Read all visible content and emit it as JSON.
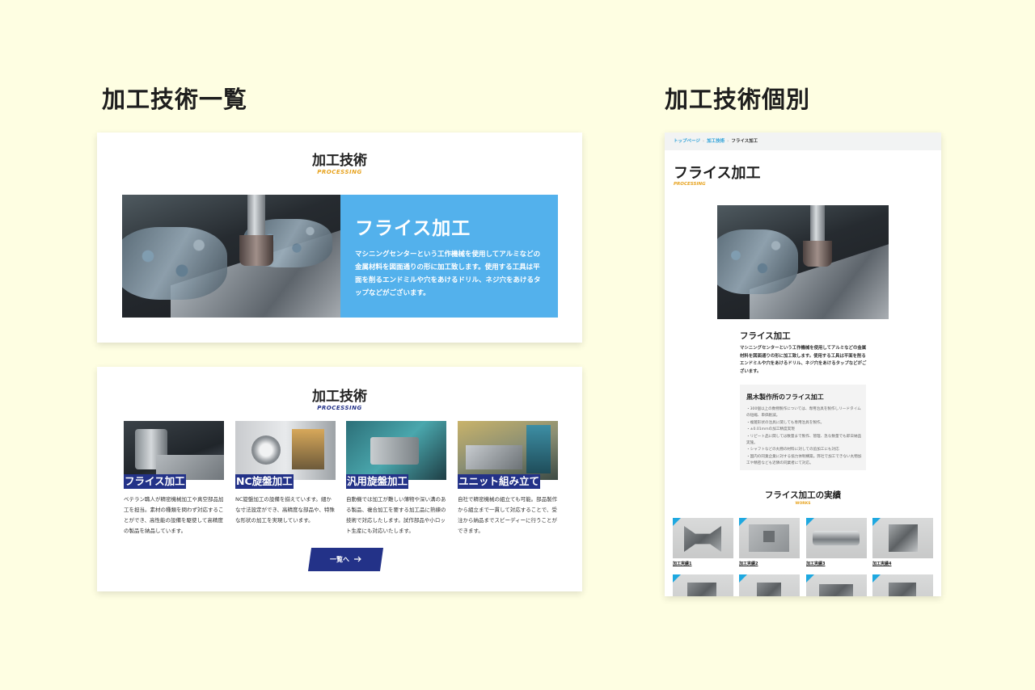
{
  "headings": {
    "list": "加工技術一覧",
    "detail": "加工技術個別"
  },
  "card1": {
    "title": "加工技術",
    "subtitle": "PROCESSING",
    "subtitle_color": "#e7a21d",
    "panel_title": "フライス加工",
    "panel_text": "マシニングセンターという工作機械を使用してアルミなどの金属材料を図面通りの形に加工致します。使用する工具は平面を削るエンドミルや穴をあけるドリル、ネジ穴をあけるタップなどがございます。",
    "panel_color": "#53b1ec"
  },
  "card2": {
    "title": "加工技術",
    "subtitle": "PROCESSING",
    "subtitle_color": "#233288",
    "tiles": [
      {
        "label": "フライス加工",
        "text": "ベテラン職人が精密機械加工や真空部品加工を担当。素材の種類を問わず対応することができ、高性能の設備を駆使して高精度の製品を納品しています。"
      },
      {
        "label": "NC旋盤加工",
        "text": "NC旋盤加工の設備を揃えています。細かな寸法設定ができ、高精度な部品や、特殊な形状の加工を実現しています。"
      },
      {
        "label": "汎用旋盤加工",
        "text": "自動機では加工が難しい薄物や深い溝のある製品、複合加工を要する加工品に熟練の技術で対応したします。試作部品や小ロット生産にも対応いたします。"
      },
      {
        "label": "ユニット組み立て",
        "text": "自社で精密機械の組立ても可能。部品製作から組立まで一貫して対応することで、受注から納品までスピーディーに行うことができます。"
      }
    ],
    "button_label": "一覧へ",
    "button_icon": "arrow-right-icon",
    "accent_color": "#233288"
  },
  "detail": {
    "breadcrumb": [
      "トップページ",
      "加工技術",
      "フライス加工"
    ],
    "title": "フライス加工",
    "subtitle": "PROCESSING",
    "section_title": "フライス加工",
    "section_text": "マシニングセンターという工作機械を使用してアルミなどの金属材料を図面通りの形に加工致します。使用する工具は平面を削るエンドミルや穴をあけるドリル、ネジ穴をあけるタップなどがございます。",
    "feature_title": "黒木製作所のフライス加工",
    "feature_items": [
      "・300個以上の数物製作については、専用治具を製作しリードタイムの短縮、単価削減。",
      "・複雑形状の治具に関しても専用治具を製作。",
      "・±0.01mmの加工精度実現",
      "・リピート品に関しては数量まで製作、管理、急な数量でも即日納品実施。",
      "・シャフトなどの丸物の材料に対しての追加工にも対応",
      "・国内の同業企業に対する協力体制構築。弊社で加工できない丸物加工や精密なども近隣の同業者にて対応。"
    ],
    "works_title": "フライス加工の実績",
    "works_subtitle": "WORKS",
    "works": [
      "加工実績1",
      "加工実績2",
      "加工実績3",
      "加工実績4"
    ],
    "accent_color": "#1ea8e0"
  }
}
